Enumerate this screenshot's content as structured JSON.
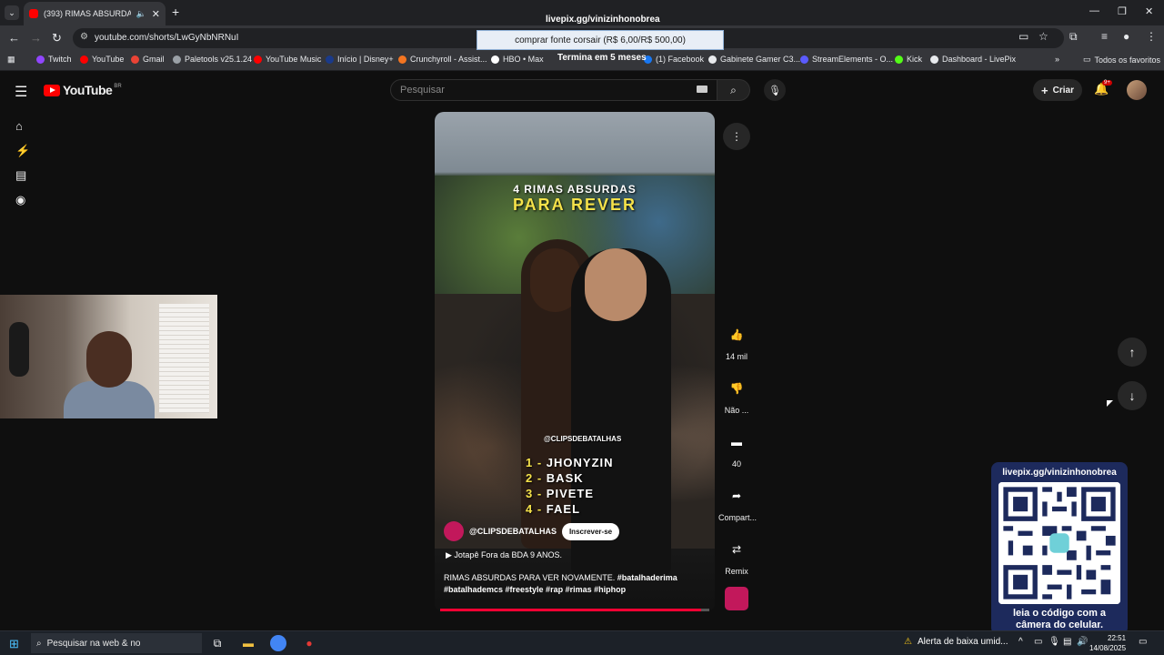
{
  "browser": {
    "tab_list_label": "⌄",
    "tab": {
      "title": "(393) RIMAS ABSURDAS PA",
      "mute": "🔈",
      "close": "✕"
    },
    "new_tab": "+",
    "window": {
      "minimize": "—",
      "restore": "❐",
      "close": "✕"
    },
    "nav": {
      "back": "←",
      "forward": "→",
      "reload": "↻"
    },
    "url": "youtube.com/shorts/LwGyNbNRNuI",
    "bookmarks": [
      {
        "label": "Twitch",
        "color": "#9146ff"
      },
      {
        "label": "YouTube",
        "color": "#ff0000"
      },
      {
        "label": "Gmail",
        "color": "#ea4335"
      },
      {
        "label": "Paletools v25.1.24",
        "color": "#9aa0a6"
      },
      {
        "label": "YouTube Music",
        "color": "#ff0000"
      },
      {
        "label": "Início | Disney+",
        "color": "#1a3a8a"
      },
      {
        "label": "Crunchyroll - Assist...",
        "color": "#f47521"
      },
      {
        "label": "HBO • Max",
        "color": "#ffffff"
      },
      {
        "label": "(1) Facebook",
        "color": "#1877f2"
      },
      {
        "label": "Gabinete Gamer C3...",
        "color": "#e8eaed"
      },
      {
        "label": "StreamElements - O...",
        "color": "#5b5bff"
      },
      {
        "label": "Kick",
        "color": "#53fc18"
      },
      {
        "label": "Dashboard - LivePix",
        "color": "#e8eaed"
      }
    ],
    "bookmarks_more": "»",
    "all_favorites": "Todos os favoritos"
  },
  "overlay": {
    "banner": "livepix.gg/vinizinhonobrea",
    "donation": "comprar fonte corsair (R$ 6,00/R$ 500,00)",
    "donation_sub": "Termina em 5 meses",
    "qr_url": "livepix.gg/vinizinhonobrea",
    "qr_caption_1": "leia o código com a",
    "qr_caption_2": "câmera do celular."
  },
  "youtube": {
    "logo": "YouTube",
    "country": "BR",
    "search_placeholder": "Pesquisar",
    "create": "Criar",
    "notif_count": "9+",
    "short": {
      "title_line1": "4 RIMAS ABSURDAS",
      "title_line2": "PARA REVER",
      "watermark": "@CLIPSDEBATALHAS",
      "ranks": [
        {
          "n": "1 -",
          "name": "JHONYZIN"
        },
        {
          "n": "2 -",
          "name": "BASK"
        },
        {
          "n": "3 -",
          "name": "PIVETE"
        },
        {
          "n": "4 -",
          "name": "FAEL"
        }
      ],
      "channel": "@CLIPSDEBATALHAS",
      "subscribe": "Inscrever-se",
      "music": "▶  Jotapê Fora da BDA 9 ANOS.",
      "desc_plain": "RIMAS ABSURDAS PARA VER NOVAMENTE.",
      "desc_tags1": "#batalhaderima",
      "desc_tags2": "#batalhademcs #freestyle #rap #rimas #hiphop",
      "progress": 0.97
    },
    "actions": {
      "like_count": "14 mil",
      "dislike_label": "Não ...",
      "comments": "40",
      "share": "Compart...",
      "remix": "Remix"
    }
  },
  "taskbar": {
    "search": "Pesquisar na web & no",
    "alert": "Alerta de baixa umid...",
    "time": "22:51",
    "date": "14/08/2025"
  }
}
